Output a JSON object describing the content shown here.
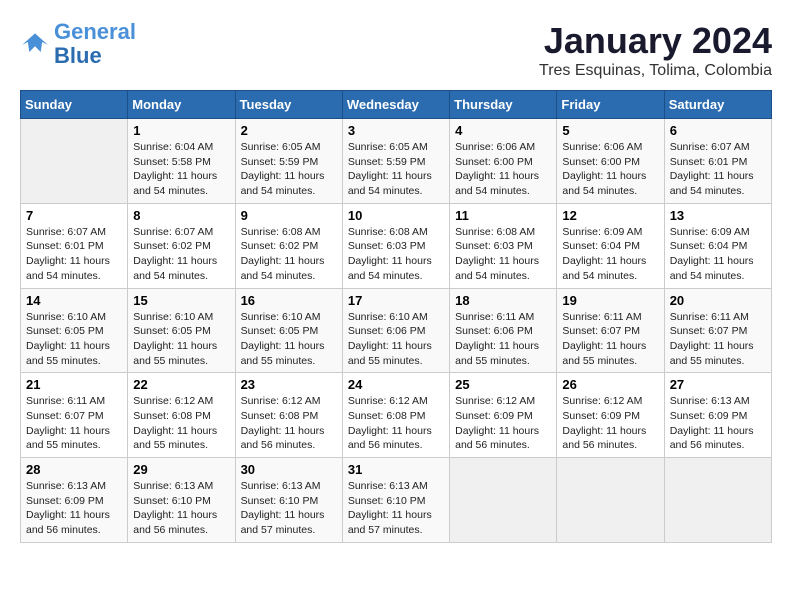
{
  "logo": {
    "line1": "General",
    "line2": "Blue"
  },
  "title": "January 2024",
  "subtitle": "Tres Esquinas, Tolima, Colombia",
  "weekdays": [
    "Sunday",
    "Monday",
    "Tuesday",
    "Wednesday",
    "Thursday",
    "Friday",
    "Saturday"
  ],
  "weeks": [
    [
      {
        "day": "",
        "info": ""
      },
      {
        "day": "1",
        "info": "Sunrise: 6:04 AM\nSunset: 5:58 PM\nDaylight: 11 hours\nand 54 minutes."
      },
      {
        "day": "2",
        "info": "Sunrise: 6:05 AM\nSunset: 5:59 PM\nDaylight: 11 hours\nand 54 minutes."
      },
      {
        "day": "3",
        "info": "Sunrise: 6:05 AM\nSunset: 5:59 PM\nDaylight: 11 hours\nand 54 minutes."
      },
      {
        "day": "4",
        "info": "Sunrise: 6:06 AM\nSunset: 6:00 PM\nDaylight: 11 hours\nand 54 minutes."
      },
      {
        "day": "5",
        "info": "Sunrise: 6:06 AM\nSunset: 6:00 PM\nDaylight: 11 hours\nand 54 minutes."
      },
      {
        "day": "6",
        "info": "Sunrise: 6:07 AM\nSunset: 6:01 PM\nDaylight: 11 hours\nand 54 minutes."
      }
    ],
    [
      {
        "day": "7",
        "info": "Sunrise: 6:07 AM\nSunset: 6:01 PM\nDaylight: 11 hours\nand 54 minutes."
      },
      {
        "day": "8",
        "info": "Sunrise: 6:07 AM\nSunset: 6:02 PM\nDaylight: 11 hours\nand 54 minutes."
      },
      {
        "day": "9",
        "info": "Sunrise: 6:08 AM\nSunset: 6:02 PM\nDaylight: 11 hours\nand 54 minutes."
      },
      {
        "day": "10",
        "info": "Sunrise: 6:08 AM\nSunset: 6:03 PM\nDaylight: 11 hours\nand 54 minutes."
      },
      {
        "day": "11",
        "info": "Sunrise: 6:08 AM\nSunset: 6:03 PM\nDaylight: 11 hours\nand 54 minutes."
      },
      {
        "day": "12",
        "info": "Sunrise: 6:09 AM\nSunset: 6:04 PM\nDaylight: 11 hours\nand 54 minutes."
      },
      {
        "day": "13",
        "info": "Sunrise: 6:09 AM\nSunset: 6:04 PM\nDaylight: 11 hours\nand 54 minutes."
      }
    ],
    [
      {
        "day": "14",
        "info": "Sunrise: 6:10 AM\nSunset: 6:05 PM\nDaylight: 11 hours\nand 55 minutes."
      },
      {
        "day": "15",
        "info": "Sunrise: 6:10 AM\nSunset: 6:05 PM\nDaylight: 11 hours\nand 55 minutes."
      },
      {
        "day": "16",
        "info": "Sunrise: 6:10 AM\nSunset: 6:05 PM\nDaylight: 11 hours\nand 55 minutes."
      },
      {
        "day": "17",
        "info": "Sunrise: 6:10 AM\nSunset: 6:06 PM\nDaylight: 11 hours\nand 55 minutes."
      },
      {
        "day": "18",
        "info": "Sunrise: 6:11 AM\nSunset: 6:06 PM\nDaylight: 11 hours\nand 55 minutes."
      },
      {
        "day": "19",
        "info": "Sunrise: 6:11 AM\nSunset: 6:07 PM\nDaylight: 11 hours\nand 55 minutes."
      },
      {
        "day": "20",
        "info": "Sunrise: 6:11 AM\nSunset: 6:07 PM\nDaylight: 11 hours\nand 55 minutes."
      }
    ],
    [
      {
        "day": "21",
        "info": "Sunrise: 6:11 AM\nSunset: 6:07 PM\nDaylight: 11 hours\nand 55 minutes."
      },
      {
        "day": "22",
        "info": "Sunrise: 6:12 AM\nSunset: 6:08 PM\nDaylight: 11 hours\nand 55 minutes."
      },
      {
        "day": "23",
        "info": "Sunrise: 6:12 AM\nSunset: 6:08 PM\nDaylight: 11 hours\nand 56 minutes."
      },
      {
        "day": "24",
        "info": "Sunrise: 6:12 AM\nSunset: 6:08 PM\nDaylight: 11 hours\nand 56 minutes."
      },
      {
        "day": "25",
        "info": "Sunrise: 6:12 AM\nSunset: 6:09 PM\nDaylight: 11 hours\nand 56 minutes."
      },
      {
        "day": "26",
        "info": "Sunrise: 6:12 AM\nSunset: 6:09 PM\nDaylight: 11 hours\nand 56 minutes."
      },
      {
        "day": "27",
        "info": "Sunrise: 6:13 AM\nSunset: 6:09 PM\nDaylight: 11 hours\nand 56 minutes."
      }
    ],
    [
      {
        "day": "28",
        "info": "Sunrise: 6:13 AM\nSunset: 6:09 PM\nDaylight: 11 hours\nand 56 minutes."
      },
      {
        "day": "29",
        "info": "Sunrise: 6:13 AM\nSunset: 6:10 PM\nDaylight: 11 hours\nand 56 minutes."
      },
      {
        "day": "30",
        "info": "Sunrise: 6:13 AM\nSunset: 6:10 PM\nDaylight: 11 hours\nand 57 minutes."
      },
      {
        "day": "31",
        "info": "Sunrise: 6:13 AM\nSunset: 6:10 PM\nDaylight: 11 hours\nand 57 minutes."
      },
      {
        "day": "",
        "info": ""
      },
      {
        "day": "",
        "info": ""
      },
      {
        "day": "",
        "info": ""
      }
    ]
  ]
}
